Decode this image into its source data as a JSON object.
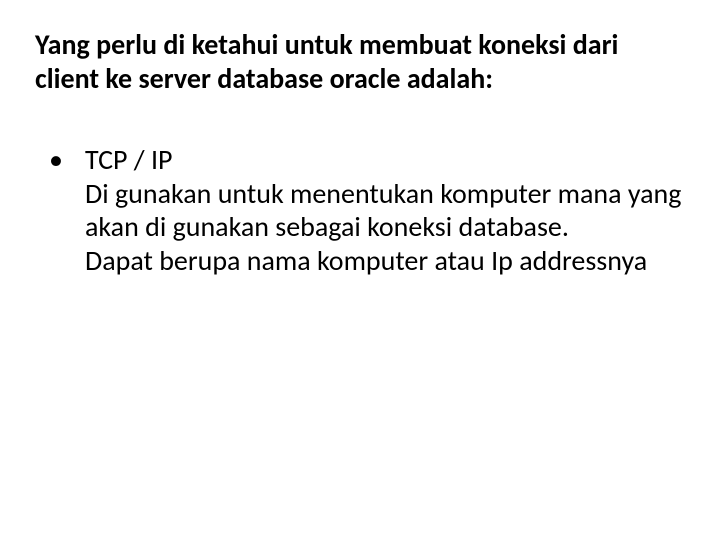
{
  "heading": "Yang perlu di ketahui untuk membuat koneksi dari client ke server database oracle adalah:",
  "bullet": {
    "marker": "•",
    "title": "TCP / IP",
    "detail1": "Di gunakan untuk menentukan komputer mana yang akan di gunakan sebagai koneksi database.",
    "detail2": "Dapat berupa nama komputer atau Ip addressnya"
  }
}
